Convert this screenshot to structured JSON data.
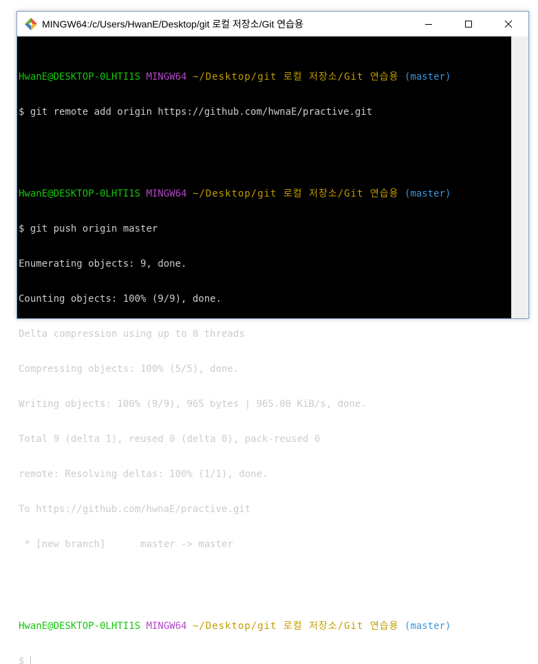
{
  "window": {
    "title": "MINGW64:/c/Users/HwanE/Desktop/git 로컬 저장소/Git 연습용"
  },
  "colors": {
    "user": "#16c60c",
    "mingw": "#b148c6",
    "path": "#c19c00",
    "branch": "#3a96dd",
    "text": "#cccccc"
  },
  "prompt": {
    "user": "HwanE@DESKTOP-0LHTI1S",
    "env": "MINGW64",
    "path": "~/Desktop/git 로컬 저장소/Git 연습용",
    "branch": "(master)",
    "symbol": "$"
  },
  "commands": {
    "cmd1": "git remote add origin https://github.com/hwnaE/practive.git",
    "cmd2": "git push origin master"
  },
  "output": [
    "Enumerating objects: 9, done.",
    "Counting objects: 100% (9/9), done.",
    "Delta compression using up to 8 threads",
    "Compressing objects: 100% (5/5), done.",
    "Writing objects: 100% (9/9), 965 bytes | 965.00 KiB/s, done.",
    "Total 9 (delta 1), reused 0 (delta 0), pack-reused 0",
    "remote: Resolving deltas: 100% (1/1), done.",
    "To https://github.com/hwnaE/practive.git",
    " * [new branch]      master -> master"
  ]
}
